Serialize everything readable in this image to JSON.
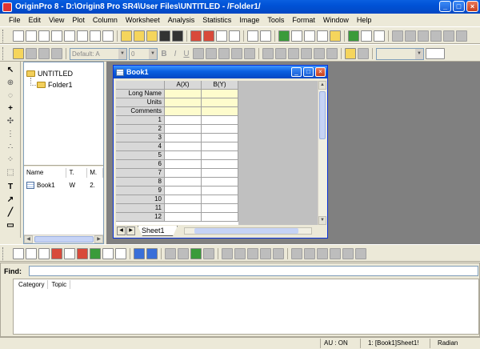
{
  "window": {
    "title": "OriginPro 8 - D:\\Origin8 Pro SR4\\User Files\\UNTITLED - /Folder1/"
  },
  "menu": [
    "File",
    "Edit",
    "View",
    "Plot",
    "Column",
    "Worksheet",
    "Analysis",
    "Statistics",
    "Image",
    "Tools",
    "Format",
    "Window",
    "Help"
  ],
  "format_bar": {
    "font": "Default: A",
    "size": "0",
    "bold": "B",
    "italic": "I",
    "underline": "U"
  },
  "explorer": {
    "root": "UNTITLED",
    "folder": "Folder1",
    "columns": [
      "Name",
      "T.",
      "M."
    ],
    "items": [
      {
        "name": "Book1",
        "type": "W",
        "modified": "2."
      }
    ]
  },
  "book": {
    "title": "Book1",
    "col_headers": [
      "A(X)",
      "B(Y)"
    ],
    "meta_rows": [
      "Long Name",
      "Units",
      "Comments"
    ],
    "rows": [
      "1",
      "2",
      "3",
      "4",
      "5",
      "6",
      "7",
      "8",
      "9",
      "10",
      "11",
      "12"
    ],
    "sheet_tab": "Sheet1"
  },
  "find": {
    "label": "Find:",
    "tabs": [
      "Category",
      "Topic"
    ]
  },
  "status": {
    "au": "AU : ON",
    "sheet": "1: [Book1]Sheet1!",
    "angle": "Radian"
  }
}
